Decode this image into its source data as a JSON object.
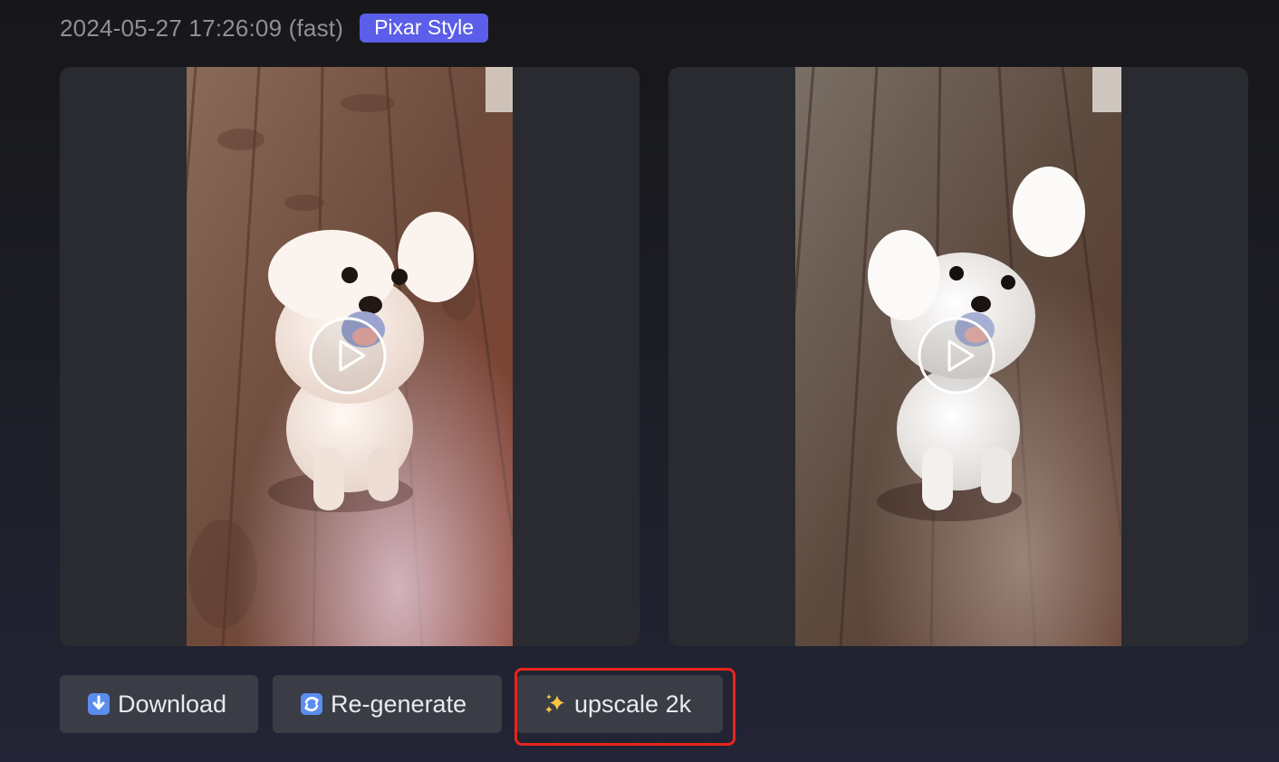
{
  "header": {
    "timestamp": "2024-05-27 17:26:09 (fast)",
    "style_badge": "Pixar Style"
  },
  "videos": [
    {
      "name": "Pixar-styled dog video",
      "play_icon": "play-icon"
    },
    {
      "name": "Original dog video",
      "play_icon": "play-icon"
    }
  ],
  "actions": {
    "download_label": "Download",
    "download_icon": "down-arrow-icon",
    "regenerate_label": "Re-generate",
    "regenerate_icon": "refresh-icon",
    "upscale_label": "upscale 2k",
    "upscale_icon": "sparkles-icon"
  },
  "colors": {
    "badge": "#5b5ee8",
    "button_bg": "#3a3c46",
    "highlight_outline": "#e8241c"
  }
}
